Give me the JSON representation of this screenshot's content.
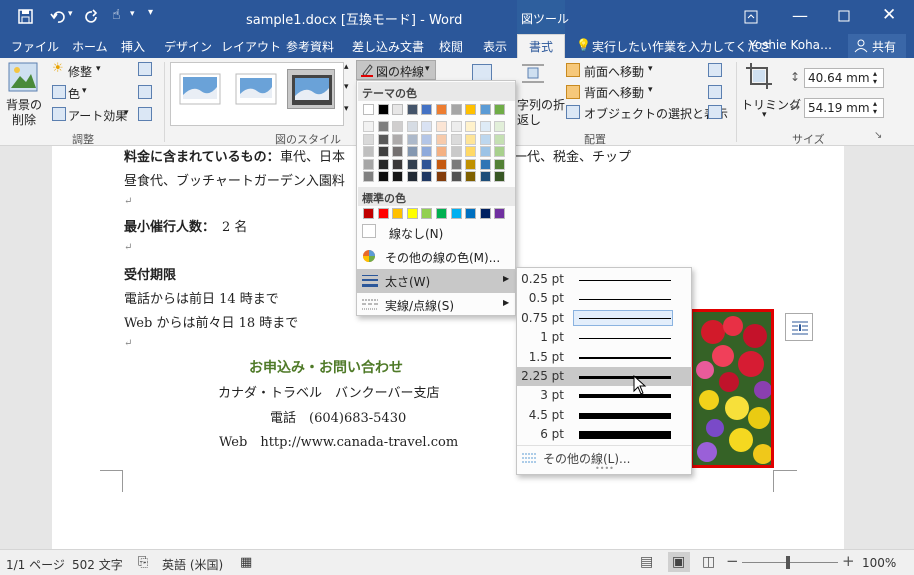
{
  "title_bar": {
    "document_title": "sample1.docx [互換モード] - Word",
    "contextual_tab_group": "図ツール"
  },
  "tabs": [
    "ファイル",
    "ホーム",
    "挿入",
    "デザイン",
    "レイアウト",
    "参考資料",
    "差し込み文書",
    "校閲",
    "表示",
    "書式"
  ],
  "active_tab": "書式",
  "tell_me": "実行したい作業を入力してくださ",
  "user_name": "Yoshie Koha…",
  "share_label": "共有",
  "ribbon": {
    "remove_bg_line1": "背景の",
    "remove_bg_line2": "削除",
    "corrections": "修整",
    "color": "色",
    "artistic_effects": "アート効果",
    "adjust_group": "調整",
    "picture_styles_group": "図のスタイル",
    "picture_border": "図の枠線",
    "wrap_text_line1": "字列の折",
    "wrap_text_line2": "返し",
    "bring_forward": "前面へ移動",
    "send_backward": "背面へ移動",
    "selection_pane": "オブジェクトの選択と表示",
    "arrange_group": "配置",
    "crop": "トリミング",
    "height_value": "40.64 mm",
    "width_value": "54.19 mm",
    "size_group": "サイズ"
  },
  "document": {
    "line1_label": "料金に含まれているもの：",
    "line1_text": "車代、日本",
    "line1_tail": "一代、税金、チップ",
    "line2": "昼食代、ブッチャートガーデン入園料",
    "min_people_label": "最小催行人数：",
    "min_people_value": "2 名",
    "deadline_label": "受付期限",
    "phone_deadline": "電話からは前日 14 時まで",
    "web_deadline": "Web からは前々日 18 時まで",
    "contact_heading": "お申込み・お問い合わせ",
    "company": "カナダ・トラベル　バンクーバー支店",
    "phone": "電話　(604)683-5430",
    "web": "Web　http://www.canada-travel.com"
  },
  "border_menu": {
    "theme_colors_header": "テーマの色",
    "standard_colors_header": "標準の色",
    "no_outline": "線なし(N)",
    "more_colors": "その他の線の色(M)...",
    "weight": "太さ(W)",
    "dashes": "実線/点線(S)",
    "theme_top_row": [
      "#ffffff",
      "#000000",
      "#e7e6e6",
      "#44546a",
      "#4472c4",
      "#ed7d31",
      "#a5a5a5",
      "#ffc000",
      "#5b9bd5",
      "#70ad47"
    ],
    "theme_columns": [
      [
        "#f2f2f2",
        "#d9d9d9",
        "#bfbfbf",
        "#a6a6a6",
        "#808080"
      ],
      [
        "#7f7f7f",
        "#595959",
        "#404040",
        "#262626",
        "#0d0d0d"
      ],
      [
        "#d0cece",
        "#aeabab",
        "#757171",
        "#3a3838",
        "#161616"
      ],
      [
        "#d6dce4",
        "#adb9ca",
        "#8497b0",
        "#323f4f",
        "#222a35"
      ],
      [
        "#d9e2f3",
        "#b4c6e7",
        "#8eaadb",
        "#2f5496",
        "#1f3864"
      ],
      [
        "#fbe5d5",
        "#f7cbac",
        "#f4b183",
        "#c55a11",
        "#833c0b"
      ],
      [
        "#ededed",
        "#dbdbdb",
        "#c9c9c9",
        "#7b7b7b",
        "#525252"
      ],
      [
        "#fff2cc",
        "#fee599",
        "#ffd966",
        "#bf9000",
        "#7f6000"
      ],
      [
        "#deebf6",
        "#bdd7ee",
        "#9cc3e5",
        "#2e75b5",
        "#1e4e79"
      ],
      [
        "#e2efd9",
        "#c5e0b3",
        "#a8d08d",
        "#538135",
        "#375623"
      ]
    ],
    "standard_colors": [
      "#c00000",
      "#ff0000",
      "#ffc000",
      "#ffff00",
      "#92d050",
      "#00b050",
      "#00b0f0",
      "#0070c0",
      "#002060",
      "#7030a0"
    ]
  },
  "weight_menu": {
    "weights": [
      {
        "label": "0.25 pt",
        "pt": 0.25
      },
      {
        "label": "0.5 pt",
        "pt": 0.5
      },
      {
        "label": "0.75 pt",
        "pt": 0.75
      },
      {
        "label": "1 pt",
        "pt": 1
      },
      {
        "label": "1.5 pt",
        "pt": 1.5
      },
      {
        "label": "2.25 pt",
        "pt": 2.25
      },
      {
        "label": "3 pt",
        "pt": 3
      },
      {
        "label": "4.5 pt",
        "pt": 4.5
      },
      {
        "label": "6 pt",
        "pt": 6
      }
    ],
    "current_weight": "0.75 pt",
    "hovered_weight": "2.25 pt",
    "more_lines": "その他の線(L)..."
  },
  "status_bar": {
    "page": "1/1 ページ",
    "word_count": "502 文字",
    "language": "英語 (米国)",
    "zoom": "100%"
  },
  "colors": {
    "accent": "#2b579a",
    "picture_border": "#e00000",
    "heading": "#4f7a28"
  }
}
